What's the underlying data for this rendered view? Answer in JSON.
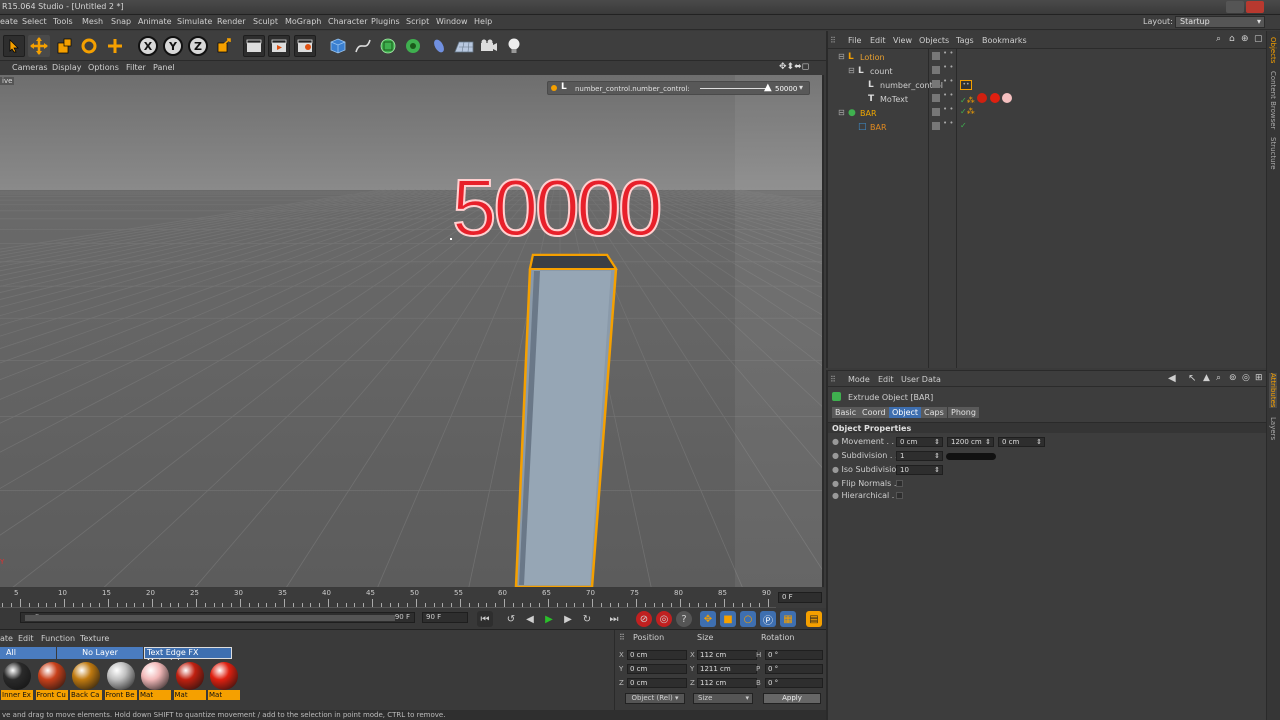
{
  "titlebar": {
    "title": "R15.064 Studio - [Untitled 2 *]"
  },
  "menubar": {
    "items": [
      "eate",
      "Select",
      "Tools",
      "Mesh",
      "Snap",
      "Animate",
      "Simulate",
      "Render",
      "Sculpt",
      "MoGraph",
      "Character",
      "Plugins",
      "Script",
      "Window",
      "Help"
    ],
    "layout_label": "Layout:",
    "layout_value": "Startup"
  },
  "toolbar": {
    "x_label": "X",
    "y_label": "Y",
    "z_label": "Z"
  },
  "viewport_menu": {
    "items": [
      "Cameras",
      "Display",
      "Options",
      "Filter",
      "Panel"
    ],
    "mode_label": "ive"
  },
  "hud": {
    "label": "number_control.number_control:",
    "value": "50000"
  },
  "scene": {
    "mo_text": "50000"
  },
  "timeline": {
    "ticks": [
      "5",
      "10",
      "15",
      "20",
      "25",
      "30",
      "35",
      "40",
      "45",
      "50",
      "55",
      "60",
      "65",
      "70",
      "75",
      "80",
      "85",
      "90"
    ],
    "current_frame": "0 F",
    "range_start": "F",
    "range_end": "90 F",
    "end_frame": "90 F"
  },
  "material_manager": {
    "menu": [
      "ate",
      "Edit",
      "Function",
      "Texture"
    ],
    "filters": [
      "All",
      "No Layer",
      "Text Edge FX Materials"
    ],
    "materials": [
      {
        "label": "Inner Ex",
        "color": "#2a2a2a"
      },
      {
        "label": "Front Cu",
        "color": "#c8401a"
      },
      {
        "label": "Back Ca",
        "color": "#c07a10"
      },
      {
        "label": "Front Be",
        "color": "#c0c0c0"
      },
      {
        "label": "Mat",
        "color": "#f2b8b8"
      },
      {
        "label": "Mat",
        "color": "#c02010"
      },
      {
        "label": "Mat",
        "color": "#e02010"
      }
    ]
  },
  "coord_manager": {
    "headers": [
      "Position",
      "Size",
      "Rotation"
    ],
    "rows": [
      {
        "axis": "X",
        "pos": "0 cm",
        "saxis": "X",
        "size": "112 cm",
        "raxis": "H",
        "rot": "0 °"
      },
      {
        "axis": "Y",
        "pos": "0 cm",
        "saxis": "Y",
        "size": "1211 cm",
        "raxis": "P",
        "rot": "0 °"
      },
      {
        "axis": "Z",
        "pos": "0 cm",
        "saxis": "Z",
        "size": "112 cm",
        "raxis": "B",
        "rot": "0 °"
      }
    ],
    "mode_select": "Object (Rel)",
    "size_select": "Size",
    "apply_label": "Apply"
  },
  "statusbar": {
    "text": "ve and drag to move elements. Hold down SHIFT to quantize movement / add to the selection in point mode, CTRL to remove."
  },
  "object_manager": {
    "menu": [
      "File",
      "Edit",
      "View",
      "Objects",
      "Tags",
      "Bookmarks"
    ],
    "objects": [
      {
        "name": "Lotion",
        "indent": 0,
        "color": "#e8a030"
      },
      {
        "name": "count",
        "indent": 1,
        "color": "#d0d0d0"
      },
      {
        "name": "number_control",
        "indent": 2,
        "color": "#d0d0d0"
      },
      {
        "name": "MoText",
        "indent": 2,
        "color": "#d0d0d0"
      },
      {
        "name": "BAR",
        "indent": 0,
        "color": "#f0a800"
      },
      {
        "name": "BAR",
        "indent": 1,
        "color": "#e08a20"
      }
    ]
  },
  "attribute_manager": {
    "menu": [
      "Mode",
      "Edit",
      "User Data"
    ],
    "object_title": "Extrude Object [BAR]",
    "tabs": [
      "Basic",
      "Coord",
      "Object",
      "Caps",
      "Phong"
    ],
    "active_tab": "Object",
    "section": "Object Properties",
    "props": {
      "movement_label": "Movement . . .",
      "movement_x": "0 cm",
      "movement_y": "1200 cm",
      "movement_z": "0 cm",
      "subdivision_label": "Subdivision . .",
      "subdivision": "1",
      "iso_label": "Iso Subdivision",
      "iso": "10",
      "flip_label": "Flip Normals . .",
      "hier_label": "Hierarchical . ."
    }
  },
  "side_tabs": [
    "Objects",
    "Content Browser",
    "Structure",
    "Attributes",
    "Layers"
  ],
  "colors": {
    "accent": "#f5a000",
    "selection": "#3e6fb0",
    "text_red": "#e8202a"
  }
}
